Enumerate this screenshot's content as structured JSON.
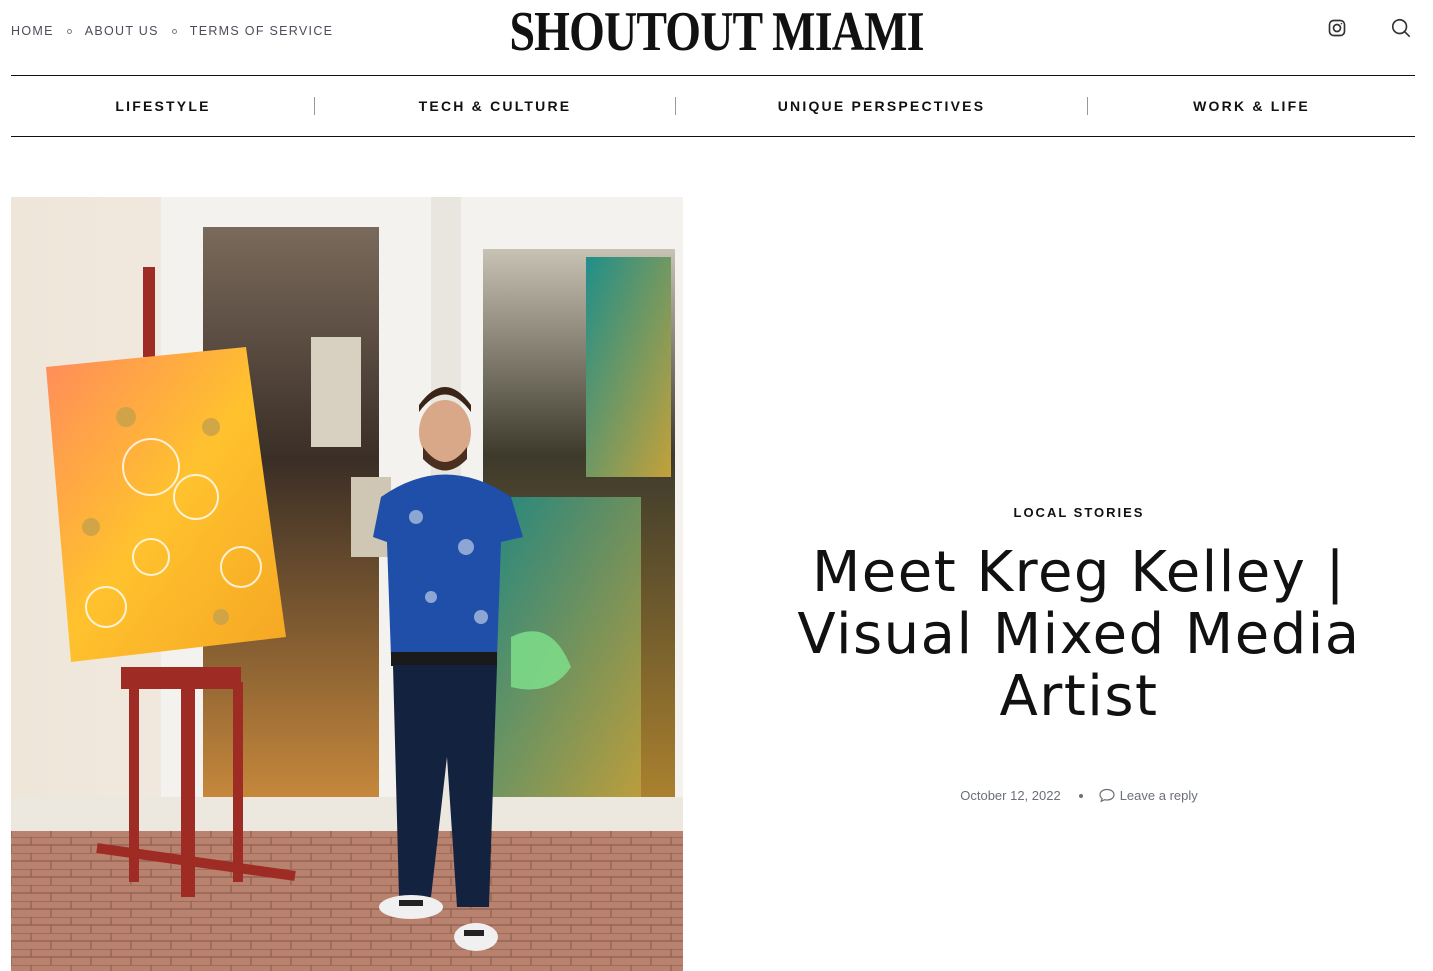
{
  "top_nav": {
    "links": [
      {
        "label": "HOME"
      },
      {
        "label": "ABOUT US"
      },
      {
        "label": "TERMS OF SERVICE"
      }
    ]
  },
  "logo": {
    "text": "SHOUTOUT MIAMI"
  },
  "header_icons": [
    "instagram-icon",
    "search-icon"
  ],
  "category_nav": {
    "items": [
      {
        "label": "LIFESTYLE"
      },
      {
        "label": "TECH & CULTURE"
      },
      {
        "label": "UNIQUE PERSPECTIVES"
      },
      {
        "label": "WORK & LIFE"
      }
    ]
  },
  "article": {
    "category": "LOCAL STORIES",
    "title": "Meet Kreg Kelley | Visual Mixed Media Artist",
    "date": "October 12, 2022",
    "reply_label": "Leave a reply"
  },
  "colors": {
    "text": "#111111",
    "muted": "#6b6f7a",
    "rule": "#111111"
  }
}
